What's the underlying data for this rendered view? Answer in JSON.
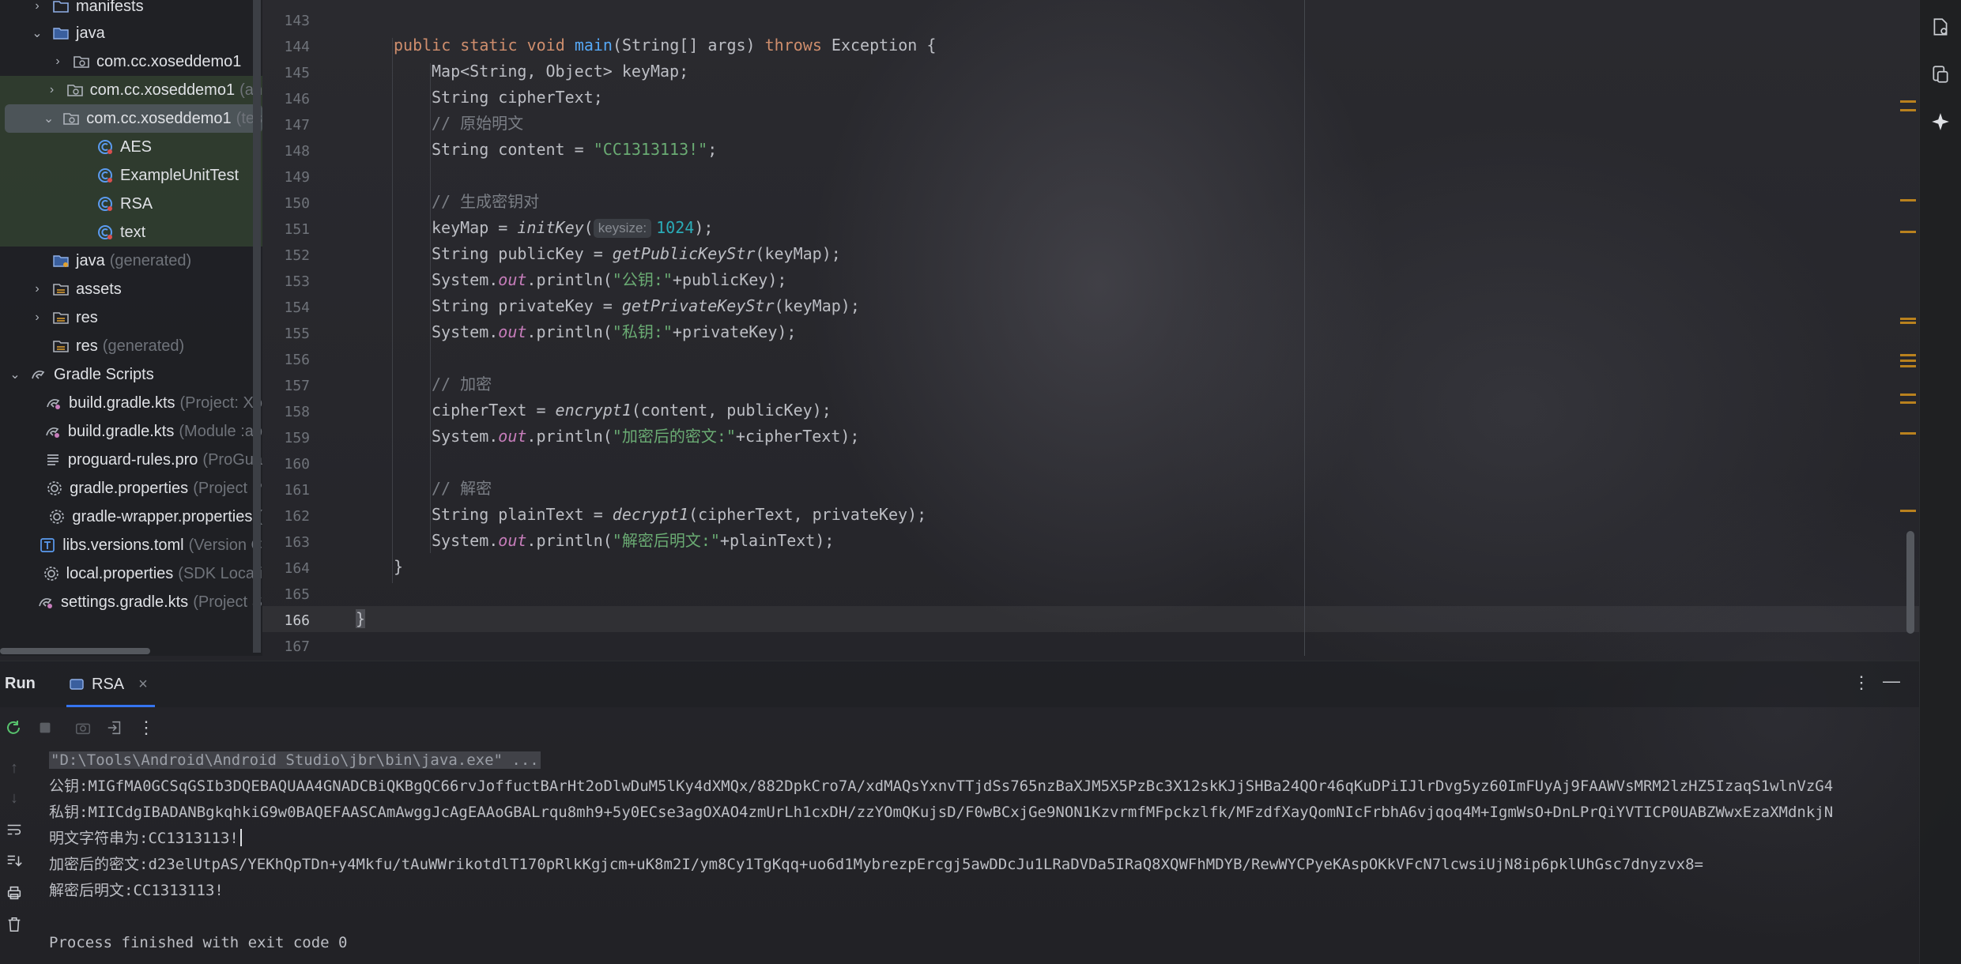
{
  "project_tree": {
    "items": [
      {
        "label": "manifests",
        "hint": ""
      },
      {
        "label": "java",
        "hint": ""
      },
      {
        "label": "com.cc.xoseddemo1",
        "hint": ""
      },
      {
        "label": "com.cc.xoseddemo1",
        "hint": "(an"
      },
      {
        "label": "com.cc.xoseddemo1",
        "hint": "(tes"
      },
      {
        "label": "AES",
        "hint": ""
      },
      {
        "label": "ExampleUnitTest",
        "hint": ""
      },
      {
        "label": "RSA",
        "hint": ""
      },
      {
        "label": "text",
        "hint": ""
      },
      {
        "label": "java",
        "hint": "(generated)"
      },
      {
        "label": "assets",
        "hint": ""
      },
      {
        "label": "res",
        "hint": ""
      },
      {
        "label": "res",
        "hint": "(generated)"
      },
      {
        "label": "Gradle Scripts",
        "hint": ""
      },
      {
        "label": "build.gradle.kts",
        "hint": "(Project: Xo"
      },
      {
        "label": "build.gradle.kts",
        "hint": "(Module :ap"
      },
      {
        "label": "proguard-rules.pro",
        "hint": "(ProGua"
      },
      {
        "label": "gradle.properties",
        "hint": "(Project P"
      },
      {
        "label": "gradle-wrapper.properties",
        "hint": "("
      },
      {
        "label": "libs.versions.toml",
        "hint": "(Version C"
      },
      {
        "label": "local.properties",
        "hint": "(SDK Locati"
      },
      {
        "label": "settings.gradle.kts",
        "hint": "(Project S"
      }
    ]
  },
  "editor": {
    "line_numbers": [
      "143",
      "144",
      "145",
      "146",
      "147",
      "148",
      "149",
      "150",
      "151",
      "152",
      "153",
      "154",
      "155",
      "156",
      "157",
      "158",
      "159",
      "160",
      "161",
      "162",
      "163",
      "164",
      "165",
      "166",
      "167"
    ],
    "current_line": "166",
    "code": {
      "l144_kw1": "public",
      "l144_kw2": "static",
      "l144_kw3": "void",
      "l144_fn": "main",
      "l144_a": "(String[] args) ",
      "l144_kw4": "throws",
      "l144_b": " Exception {",
      "l145": "Map<String, Object> keyMap;",
      "l146": "String cipherText;",
      "l147_cm": "// 原始明文",
      "l148_a": "String content = ",
      "l148_st": "\"CC1313113!\"",
      "l148_b": ";",
      "l150_cm": "// 生成密钥对",
      "l151_a": "keyMap = ",
      "l151_fn": "initKey",
      "l151_b": "(",
      "l151_hint": "keysize:",
      "l151_num": "1024",
      "l151_c": ");",
      "l152_a": "String publicKey = ",
      "l152_fn": "getPublicKeyStr",
      "l152_b": "(keyMap);",
      "l153_a": "System.",
      "l153_fld": "out",
      "l153_b": ".println(",
      "l153_st": "\"公钥:\"",
      "l153_c": "+publicKey);",
      "l154_a": "String privateKey = ",
      "l154_fn": "getPrivateKeyStr",
      "l154_b": "(keyMap);",
      "l155_a": "System.",
      "l155_fld": "out",
      "l155_b": ".println(",
      "l155_st": "\"私钥:\"",
      "l155_c": "+privateKey);",
      "l157_cm": "// 加密",
      "l158_a": "cipherText = ",
      "l158_fn": "encrypt1",
      "l158_b": "(content, publicKey);",
      "l159_a": "System.",
      "l159_fld": "out",
      "l159_b": ".println(",
      "l159_st": "\"加密后的密文:\"",
      "l159_c": "+cipherText);",
      "l161_cm": "// 解密",
      "l162_a": "String plainText = ",
      "l162_fn": "decrypt1",
      "l162_b": "(cipherText, privateKey);",
      "l163_a": "System.",
      "l163_fld": "out",
      "l163_b": ".println(",
      "l163_st": "\"解密后明文:\"",
      "l163_c": "+plainText);",
      "l164": "}",
      "l166": "}"
    }
  },
  "run_panel": {
    "title": "Run",
    "tab_label": "RSA",
    "console": {
      "command": "\"D:\\Tools\\Android\\Android Studio\\jbr\\bin\\java.exe\" ...",
      "public_key_line": "公钥:MIGfMA0GCSqGSIb3DQEBAQUAA4GNADCBiQKBgQC66rvJoffuctBArHt2oDlwDuM5lKy4dXMQx/882DpkCro7A/xdMAQsYxnvTTjdSs765nzBaXJM5X5PzBc3X12skKJjSHBa24QOr46qKuDPiIJlrDvg5yz60ImFUyAj9FAAWVsMRM2lzHZ5IzaqS1wlnVzG4",
      "private_key_line": "私钥:MIICdgIBADANBgkqhkiG9w0BAQEFAASCAmAwggJcAgEAAoGBALrqu8mh9+5y0ECse3agOXAO4zmUrLh1cxDH/zzYOmQKujsD/F0wBCxjGe9NON1KzvrmfMFpckzlfk/MFzdfXayQomNIcFrbhA6vjqoq4M+IgmWsO+DnLPrQiYVTICP0UABZWwxEzaXMdnkjN",
      "plaintext_line": "明文字符串为:CC1313113!",
      "ciphertext_line": "加密后的密文:d23elUtpAS/YEKhQpTDn+y4Mkfu/tAuWWrikotdlT170pRlkKgjcm+uK8m2I/ym8Cy1TgKqq+uo6d1MybrezpErcgj5awDDcJu1LRaDVDa5IRaQ8XQWFhMDYB/RewWYCPyeKAspOKkVFcN7lcwsiUjN8ip6pklUhGsc7dnyzvx8=",
      "decrypted_line": "解密后明文:CC1313113!",
      "exit_line": "Process finished with exit code 0"
    }
  },
  "colors": {
    "keyword": "#cf8e6d",
    "function": "#56a8f5",
    "string": "#6aab73",
    "comment": "#7a7e85",
    "number": "#2aacb8",
    "field": "#c77dbb",
    "accent": "#3574f0"
  }
}
